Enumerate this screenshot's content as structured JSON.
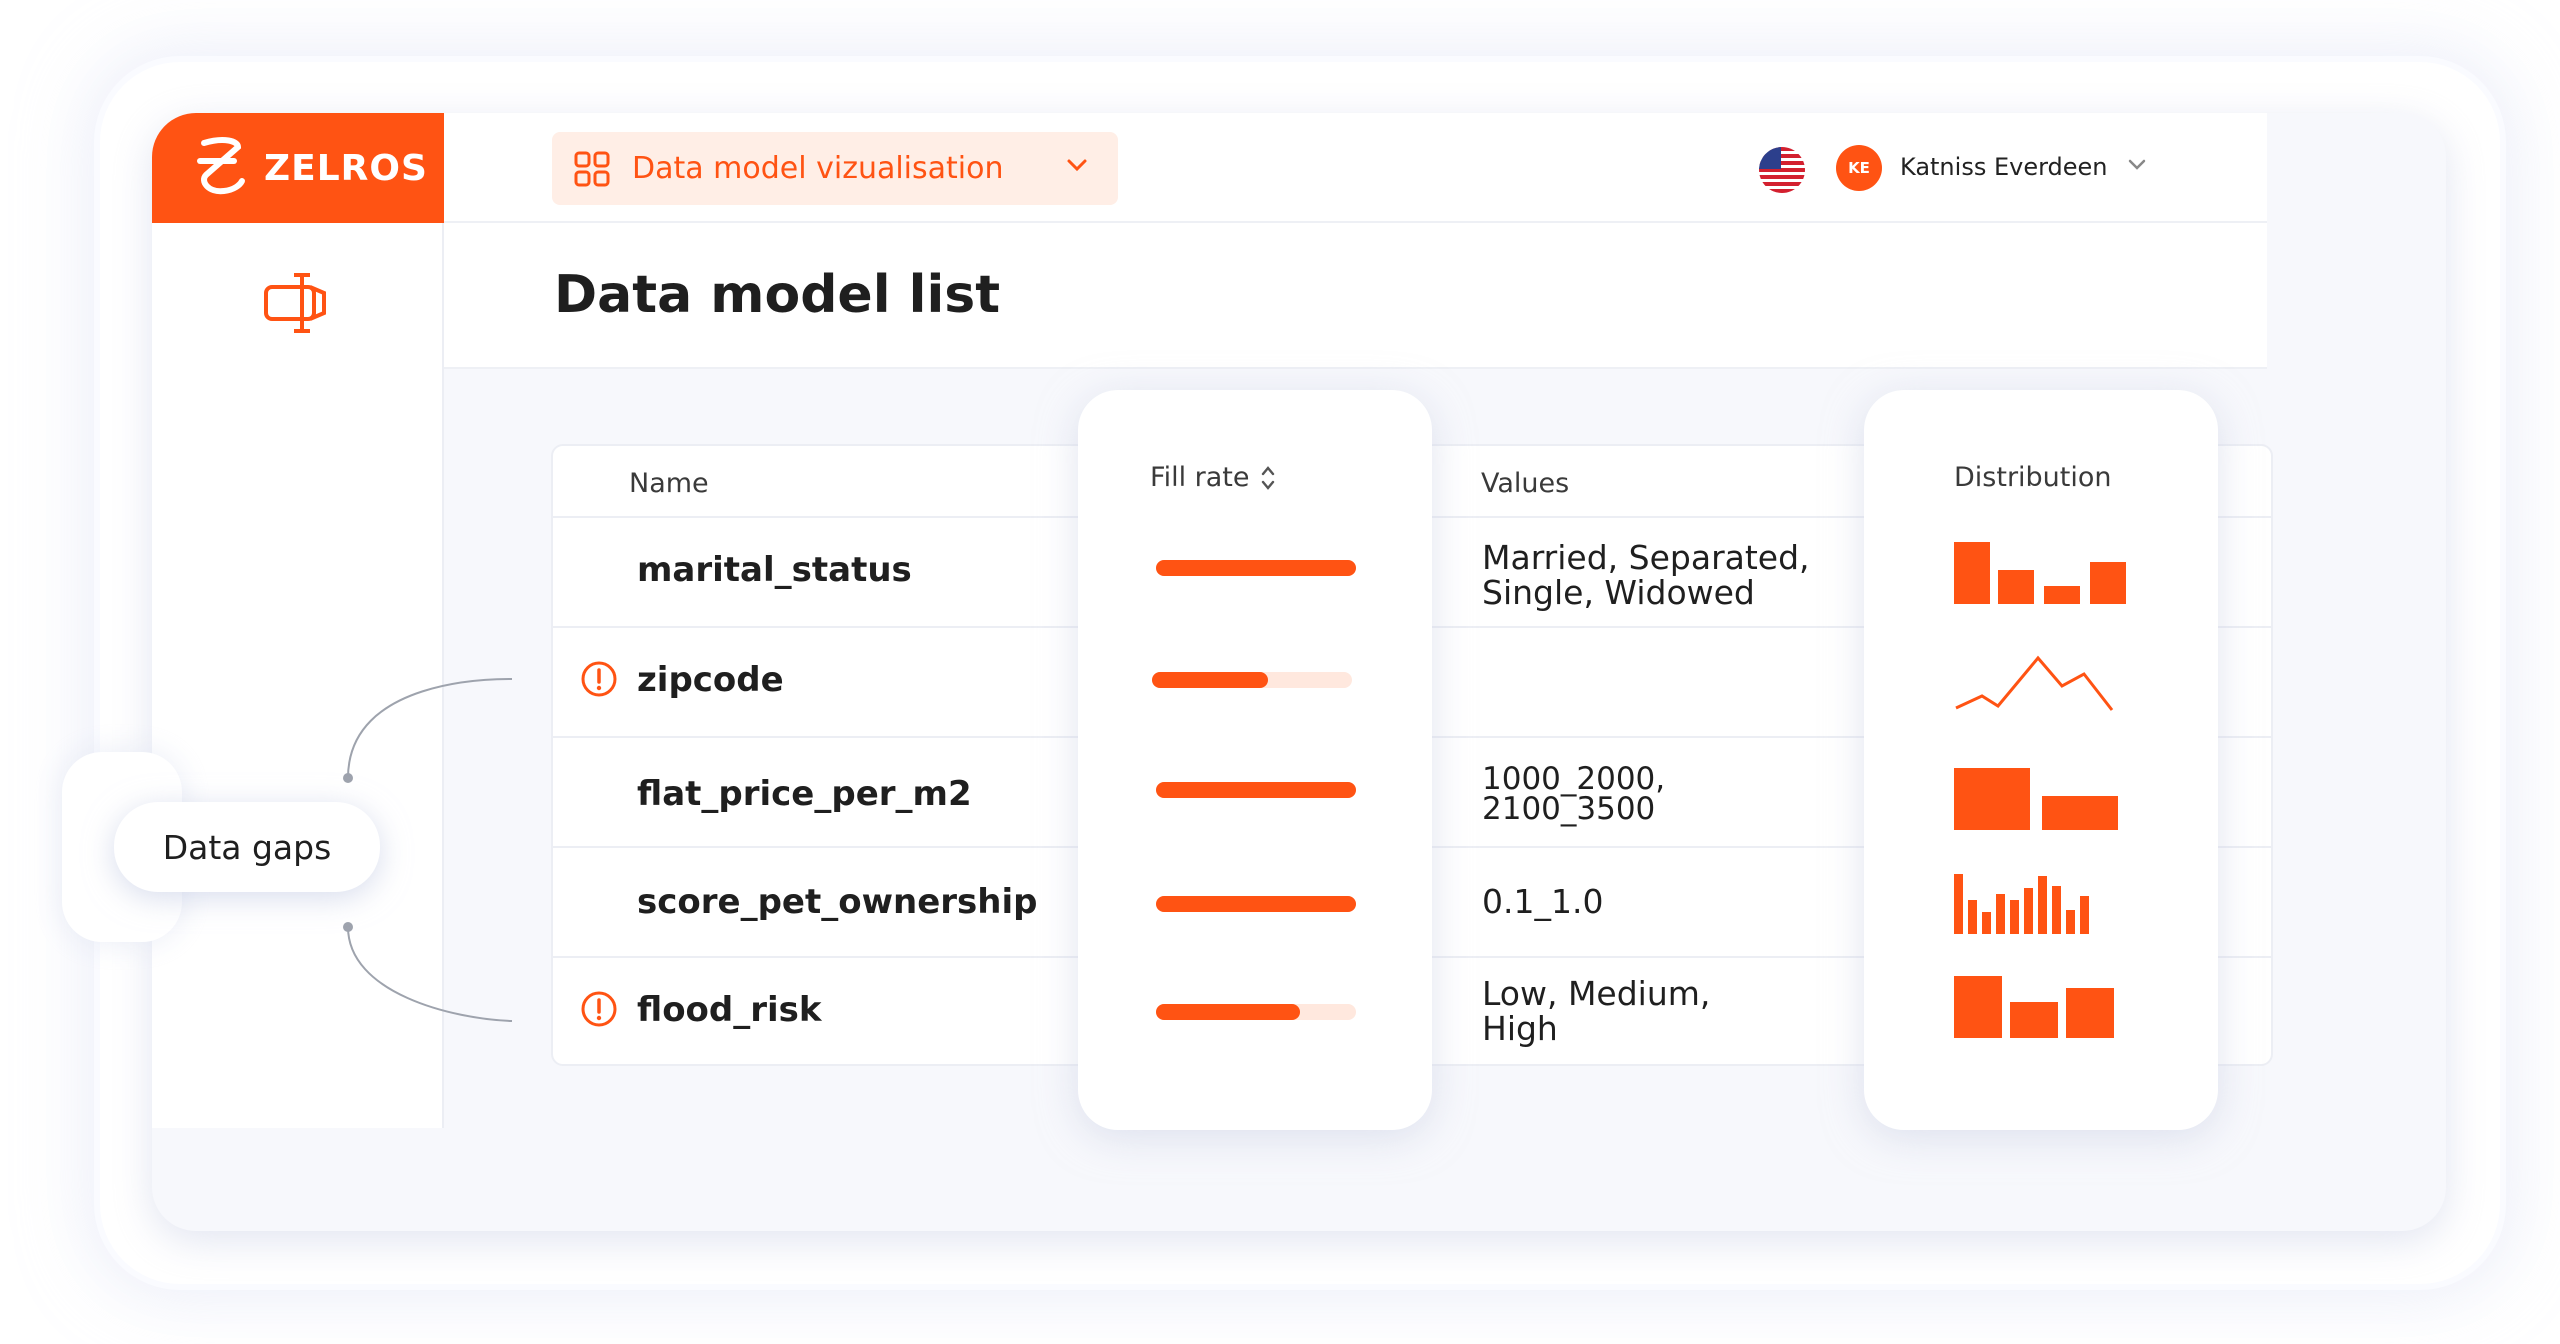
{
  "brand": {
    "name": "ZELROS",
    "accent": "#ff5313"
  },
  "topbar": {
    "dropdown_label": "Data model vizualisation",
    "user": {
      "initials": "KE",
      "name": "Katniss Everdeen"
    }
  },
  "page": {
    "title": "Data model list"
  },
  "table": {
    "columns": {
      "name": "Name",
      "fill_rate": "Fill rate",
      "values": "Values",
      "distribution": "Distribution"
    },
    "rows": [
      {
        "name": "marital_status",
        "warning": false,
        "fill_rate": 1.0,
        "values_line1": "Married, Separated,",
        "values_line2": "Single, Widowed",
        "distribution": "bars"
      },
      {
        "name": "zipcode",
        "warning": true,
        "fill_rate": 0.58,
        "values_line1": "",
        "values_line2": "",
        "distribution": "line"
      },
      {
        "name": "flat_price_per_m2",
        "warning": false,
        "fill_rate": 1.0,
        "values_line1": "1000_2000,",
        "values_line2": "2100_3500",
        "distribution": "bars"
      },
      {
        "name": "score_pet_ownership",
        "warning": false,
        "fill_rate": 1.0,
        "values_line1": "0.1_1.0",
        "values_line2": "",
        "distribution": "bars"
      },
      {
        "name": "flood_risk",
        "warning": true,
        "fill_rate": 0.72,
        "values_line1": "Low, Medium,",
        "values_line2": "High",
        "distribution": "bars"
      }
    ]
  },
  "callout": {
    "label": "Data gaps"
  },
  "icons": {
    "sidebar": "data-model-icon",
    "warning": "warning-icon",
    "grid": "grid-icon",
    "sort": "sort-icon",
    "chevron": "chevron-down-icon",
    "flag": "us-flag-icon"
  }
}
